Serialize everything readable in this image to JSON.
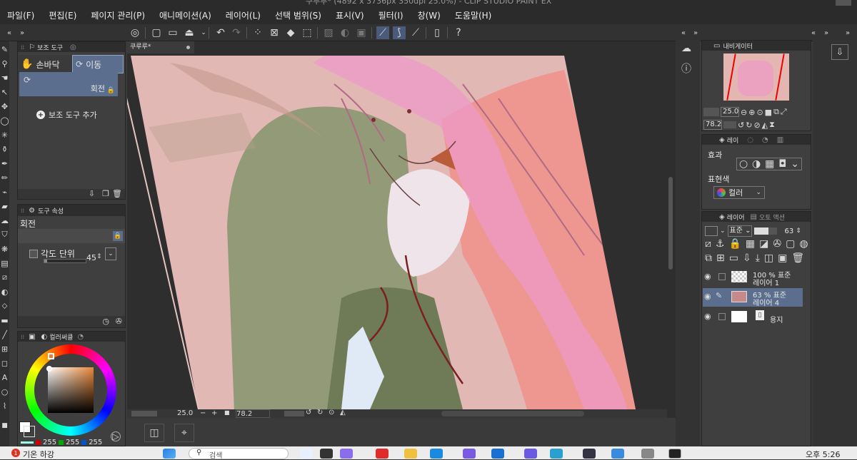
{
  "app": {
    "title": "쿠루루* (4892 x 3736px 350dpi 25.0%) - CLIP STUDIO PAINT EX"
  },
  "menu": [
    "파일(F)",
    "편집(E)",
    "페이지 관리(P)",
    "애니메이션(A)",
    "레이어(L)",
    "선택 범위(S)",
    "표시(V)",
    "필터(I)",
    "창(W)",
    "도움말(H)"
  ],
  "sub_tool": {
    "header": "보조 도구",
    "tabs": [
      "손바닥",
      "이동"
    ],
    "selected_item": "회전",
    "add_label": "보조 도구 추가"
  },
  "tool_property": {
    "header": "도구 속성",
    "title": "회전",
    "angle_unit_label": "각도 단위",
    "angle_value": "45"
  },
  "color_wheel": {
    "header": "컬러써클",
    "r": "255",
    "g": "255",
    "b": "255",
    "colors": {
      "ring_accent": "#e0803a",
      "square_top": "#e8883a"
    }
  },
  "canvas": {
    "tab_title": "쿠루루*",
    "zoom": "25.0",
    "rotation": "78.2"
  },
  "navigator": {
    "header": "내비게이터",
    "zoom": "25.0",
    "rotation": "78.2"
  },
  "layer_property": {
    "tab_label": "레이",
    "effect_label": "효과",
    "expression_label": "표현색",
    "expression_value": "컬러"
  },
  "layer_panel": {
    "tabs": [
      "레이어",
      "오토 액션"
    ],
    "blend_mode": "표준",
    "opacity": "63",
    "layers": [
      {
        "line1": "100 % 표준",
        "line2": "레이어 1",
        "selected": false
      },
      {
        "line1": "63 % 표준",
        "line2": "레이어 4",
        "selected": true
      },
      {
        "line1": "",
        "line2": "용지",
        "selected": false
      }
    ]
  },
  "taskbar": {
    "weather_badge": "1",
    "weather_text": "기온 하강",
    "search_placeholder": "검색",
    "clock": "오후 5:26"
  }
}
